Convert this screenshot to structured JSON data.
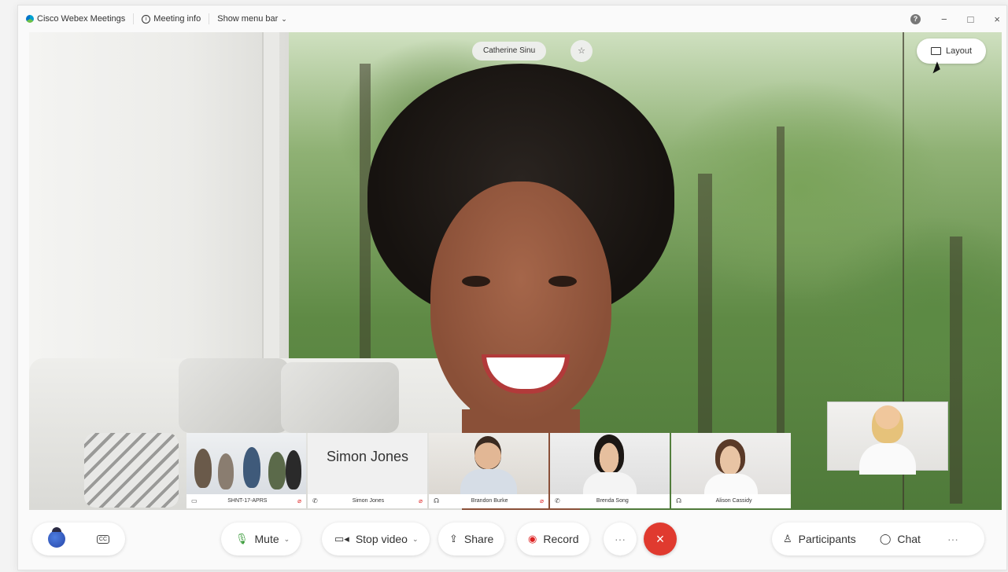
{
  "titlebar": {
    "app_title": "Cisco Webex Meetings",
    "meeting_info": "Meeting info",
    "show_menu_bar": "Show menu bar",
    "help": "?",
    "minimize": "−",
    "maximize": "□",
    "close": "×"
  },
  "stage": {
    "active_speaker_name": "Catherine Sinu",
    "pin": "☆",
    "layout_label": "Layout"
  },
  "filmstrip": [
    {
      "name": "SHNT-17-APRS",
      "type": "video-room",
      "muted": true
    },
    {
      "name": "Simon Jones",
      "type": "name-only",
      "muted": true,
      "display_name": "Simon Jones"
    },
    {
      "name": "Brandon Burke",
      "type": "video",
      "muted": true
    },
    {
      "name": "Brenda Song",
      "type": "video",
      "muted": false
    },
    {
      "name": "Alison Cassidy",
      "type": "video",
      "muted": false
    }
  ],
  "controls": {
    "mute": "Mute",
    "stop_video": "Stop video",
    "share": "Share",
    "record": "Record",
    "more": "···",
    "end": "×",
    "participants": "Participants",
    "chat": "Chat",
    "more_right": "···"
  },
  "colors": {
    "end_red": "#e03a2f",
    "accent": "#0074c8"
  }
}
